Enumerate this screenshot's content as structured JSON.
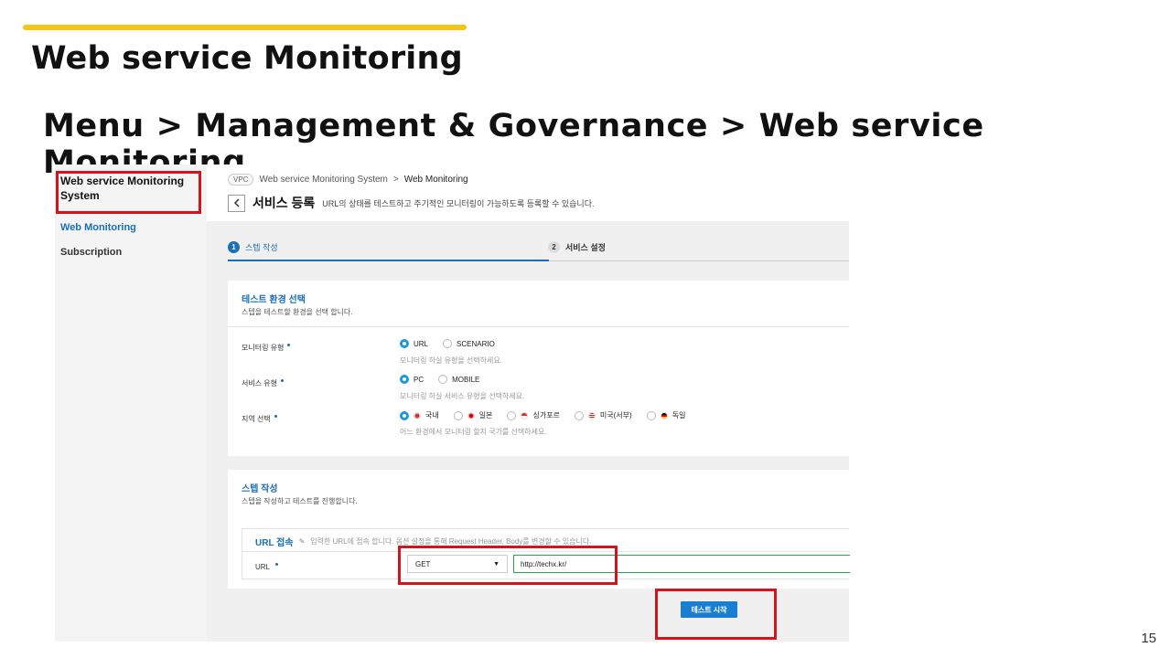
{
  "slide": {
    "title": "Web service Monitoring",
    "subtitle": "Menu > Management & Governance > Web service Monitoring",
    "page_number": "15",
    "accent_color": "#f5c518",
    "highlight_color": "#d4141c"
  },
  "sidebar": {
    "title": "Web service Monitoring System",
    "items": [
      {
        "label": "Web Monitoring",
        "active": true
      },
      {
        "label": "Subscription",
        "active": false
      }
    ]
  },
  "breadcrumb": {
    "badge": "VPC",
    "items": [
      "Web service Monitoring System",
      "Web Monitoring"
    ],
    "separator": ">"
  },
  "header": {
    "back_icon": "chevron-left-icon",
    "title": "서비스 등록",
    "description": "URL의 상태를 테스트하고 주기적인 모니터링이 가능하도록 등록할 수 있습니다."
  },
  "steps": [
    {
      "number": "1",
      "label": "스텝 작성",
      "active": true
    },
    {
      "number": "2",
      "label": "서비스 설정",
      "active": false
    }
  ],
  "env_section": {
    "title": "테스트 환경 선택",
    "description": "스텝을 테스트할 환경을 선택 합니다.",
    "monitor_type": {
      "label": "모니터링 유형",
      "options": [
        "URL",
        "SCENARIO"
      ],
      "selected": "URL",
      "hint": "모니터링 하실 유형을 선택하세요."
    },
    "service_type": {
      "label": "서비스 유형",
      "options": [
        "PC",
        "MOBILE"
      ],
      "selected": "PC",
      "hint": "모니터링 하실 서비스 유형을 선택하세요."
    },
    "region": {
      "label": "지역 선택",
      "options": [
        "국내",
        "일본",
        "싱가포르",
        "미국(서부)",
        "독일"
      ],
      "selected": "국내",
      "hint": "어느 환경에서 모니터링 할지 국가를 선택하세요."
    }
  },
  "step_section": {
    "title": "스텝 작성",
    "description": "스텝을 작성하고 테스트를 진행합니다.",
    "url_block": {
      "title": "URL 접속",
      "pencil_icon": "pencil-icon",
      "description": "입력한 URL에 접속 합니다. 옵션 설정을 통해 Request Header, Body를 변경할 수 있습니다.",
      "url_label": "URL",
      "method": "GET",
      "url_value": "http://techx.kr/"
    },
    "test_button": "테스트 시작"
  },
  "colors": {
    "primary": "#1a6fb5",
    "radio_on": "#1a9ad6",
    "button": "#1a7fd0"
  }
}
